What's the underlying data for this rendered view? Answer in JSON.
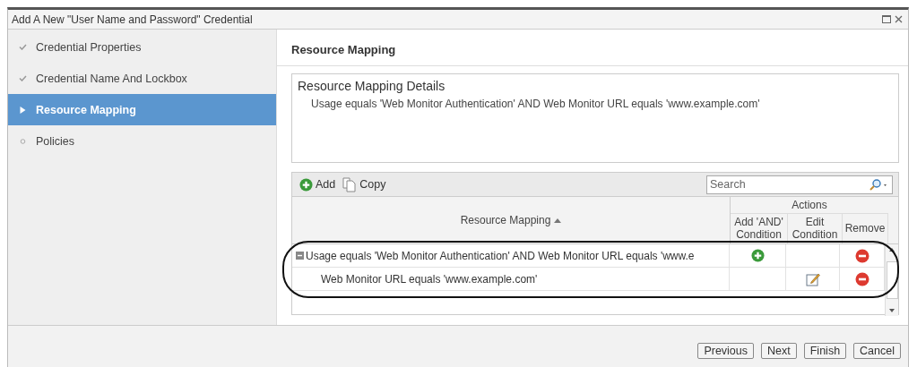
{
  "window": {
    "title": "Add A New \"User Name and Password\" Credential"
  },
  "steps": [
    {
      "label": "Credential Properties",
      "kind": "done",
      "selected": false
    },
    {
      "label": "Credential Name And Lockbox",
      "kind": "done",
      "selected": false
    },
    {
      "label": "Resource Mapping",
      "kind": "current",
      "selected": true
    },
    {
      "label": "Policies",
      "kind": "pending",
      "selected": false
    }
  ],
  "panel": {
    "title": "Resource Mapping"
  },
  "details": {
    "title": "Resource Mapping Details",
    "text": "Usage equals 'Web Monitor Authentication' AND Web Monitor URL equals 'www.example.com'"
  },
  "toolbar": {
    "add": "Add",
    "copy": "Copy",
    "search": {
      "placeholder": "Search"
    }
  },
  "table": {
    "columns": {
      "mapping": "Resource Mapping",
      "group": "Actions",
      "add": "Add 'AND' Condition",
      "edit": "Edit Condition",
      "remove": "Remove"
    },
    "rows": [
      {
        "kind": "group",
        "text": "Usage equals 'Web Monitor Authentication' AND Web Monitor URL equals 'www.e",
        "expanded": true,
        "can_add": true,
        "can_edit": false,
        "can_remove": true
      },
      {
        "kind": "child",
        "text": "Web Monitor URL equals 'www.example.com'",
        "can_add": false,
        "can_edit": true,
        "can_remove": true
      }
    ]
  },
  "buttons": [
    "Previous",
    "Next",
    "Finish",
    "Cancel"
  ]
}
